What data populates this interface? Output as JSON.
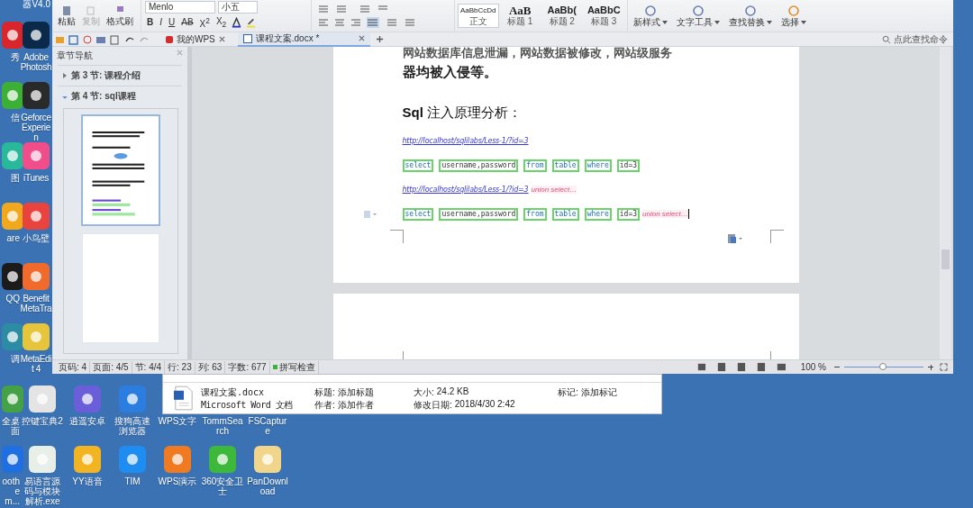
{
  "desktop": {
    "top_label": "器V4.0",
    "left_icons": [
      {
        "label": "秀",
        "kind": "tile",
        "color": "#d8262c"
      },
      {
        "label": "Adobe Photosh",
        "kind": "tile",
        "color": "#0b2a4a"
      },
      {
        "label": "信",
        "kind": "tile",
        "color": "#3cb034"
      },
      {
        "label": "Geforce Experien",
        "kind": "tile",
        "color": "#2a2a2a"
      },
      {
        "label": "图",
        "kind": "tile",
        "color": "#29b99a"
      },
      {
        "label": "iTunes",
        "kind": "tile",
        "color": "#f04d8a"
      },
      {
        "label": "are",
        "kind": "tile",
        "color": "#f2a81d"
      },
      {
        "label": "小鸟壁",
        "kind": "tile",
        "color": "#e8433c"
      },
      {
        "label": "QQ",
        "kind": "tile",
        "color": "#1b1b1b"
      },
      {
        "label": "Benefit MetaTra",
        "kind": "tile",
        "color": "#f06a2b"
      },
      {
        "label": "调",
        "kind": "tile",
        "color": "#2b8ca3"
      },
      {
        "label": "MetaEdit 4",
        "kind": "tile",
        "color": "#e7c53a"
      }
    ],
    "bottom_icons": [
      {
        "label": "全桌面",
        "kind": "tile",
        "color": "#45a145"
      },
      {
        "label": "控键宝典2",
        "kind": "tile",
        "color": "#e4e4e4"
      },
      {
        "label": "逍遥安卓",
        "kind": "tile",
        "color": "#6a5fd8"
      },
      {
        "label": "搜狗高速浏览器",
        "kind": "tile",
        "color": "#2b7de0"
      },
      {
        "label": "WPS文字",
        "kind": "covered"
      },
      {
        "label": "TommSearch",
        "kind": "covered"
      },
      {
        "label": "FSCapture",
        "kind": "covered"
      },
      {
        "label": "ooth em...",
        "kind": "tile",
        "color": "#1f6fe0"
      },
      {
        "label": "易语言源码与模块解析.exe",
        "kind": "tile",
        "color": "#e8eee8"
      },
      {
        "label": "YY语音",
        "kind": "tile",
        "color": "#f3b422"
      },
      {
        "label": "TIM",
        "kind": "tile",
        "color": "#1e8cf0"
      },
      {
        "label": "WPS演示",
        "kind": "tile",
        "color": "#f07a22"
      },
      {
        "label": "360安全卫士",
        "kind": "tile",
        "color": "#3db83a"
      },
      {
        "label": "PanDownload",
        "kind": "tile",
        "color": "#f1d58a"
      }
    ]
  },
  "ribbon": {
    "clipboard": [
      {
        "label": "粘贴",
        "disabled": false
      },
      {
        "label": "复制",
        "disabled": true
      },
      {
        "label": "格式刷",
        "disabled": false
      }
    ],
    "font_name": "Menlo",
    "font_size": "小五",
    "format_buttons": [
      "B",
      "I",
      "U",
      "AB",
      "X$^{2}$",
      "X$_{2}$"
    ],
    "styles": [
      {
        "preview": "AaBbCcDd",
        "label": "正文",
        "selected": true
      },
      {
        "preview": "AaB",
        "label": "标题 1",
        "selected": false
      },
      {
        "preview": "AaBb(",
        "label": "标题 2",
        "selected": false
      },
      {
        "preview": "AaBbC",
        "label": "标题 3",
        "selected": false
      }
    ],
    "commands": [
      "新样式",
      "文字工具",
      "查找替换",
      "选择"
    ]
  },
  "tabs": [
    {
      "label": "我的WPS",
      "selected": false
    },
    {
      "label": "课程文案.docx *",
      "selected": true
    }
  ],
  "command_search": {
    "placeholder": "点此查找命令"
  },
  "navigation": {
    "title": "章节导航",
    "items": [
      {
        "label": "第 3 节: 课程介绍",
        "expanded": false
      },
      {
        "label": "第 4 节: sql课程",
        "expanded": true
      }
    ],
    "pages": [
      {
        "selected": true
      },
      {
        "selected": false
      }
    ]
  },
  "document": {
    "lines": [
      "网站数据库信息泄漏，网站数据被修改，网站级服务",
      "器均被入侵等。"
    ],
    "heading": "**Sql** 注入原理分析：",
    "blocks": [
      {
        "kind": "link",
        "text": "http://localhost/sqlilabs/Less-1/?id=3"
      },
      {
        "kind": "code",
        "tokens": [
          {
            "text": "select",
            "keyword": true
          },
          {
            "text": "username,password",
            "keyword": false
          },
          {
            "text": "from",
            "keyword": true
          },
          {
            "text": "table",
            "keyword": true
          },
          {
            "text": "where",
            "keyword": true
          },
          {
            "text": "id=3",
            "keyword": false
          }
        ]
      },
      {
        "kind": "link",
        "text": "http://localhost/sqlilabs/Less-1/?id=3",
        "note": "union select…"
      },
      {
        "kind": "code",
        "tokens": [
          {
            "text": "select",
            "keyword": true
          },
          {
            "text": "username,password",
            "keyword": false
          },
          {
            "text": "from",
            "keyword": true
          },
          {
            "text": "table",
            "keyword": true
          },
          {
            "text": "where",
            "keyword": true
          },
          {
            "text": "id=3",
            "keyword": false
          }
        ],
        "note": "union select…",
        "cursor": true
      }
    ]
  },
  "status_bar": {
    "items": [
      "页码: 4",
      "页面: 4/5",
      "节: 4/4",
      "行: 23",
      "列: 63",
      "字数: 677"
    ],
    "spell_check": "拼写检查",
    "zoom": "100 %",
    "zoom_level": {
      "level": 0.49
    }
  },
  "details": {
    "name": "课程文案.docx",
    "type": "Microsoft Word 文档",
    "fields": [
      {
        "label": "标题:",
        "value": "添加标题"
      },
      {
        "label": "作者:",
        "value": "添加作者"
      },
      {
        "label": "大小:",
        "value": "24.2 KB"
      },
      {
        "label": "修改日期:",
        "value": "2018/4/30 2:42"
      },
      {
        "label": "标记:",
        "value": "添加标记"
      }
    ]
  }
}
